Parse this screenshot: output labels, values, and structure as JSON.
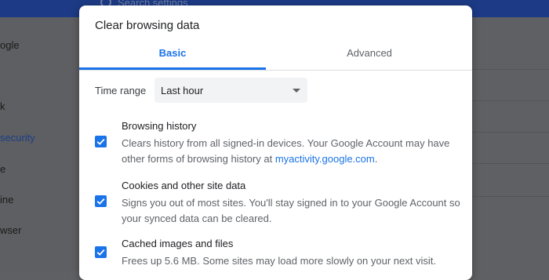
{
  "background": {
    "search_placeholder": "Search settings",
    "sidebar_fragments": [
      "ogle",
      "k",
      "security",
      "e",
      "ine",
      "wser"
    ]
  },
  "dialog": {
    "title": "Clear browsing data",
    "tabs": [
      {
        "label": "Basic",
        "selected": true
      },
      {
        "label": "Advanced",
        "selected": false
      }
    ],
    "time_range": {
      "label": "Time range",
      "value": "Last hour"
    },
    "options": [
      {
        "title": "Browsing history",
        "checked": true,
        "description": "Clears history from all signed-in devices. Your Google Account may have other forms of browsing history at ",
        "link": "myactivity.google.com",
        "after_link": "."
      },
      {
        "title": "Cookies and other site data",
        "checked": true,
        "description": "Signs you out of most sites. You'll stay signed in to your Google Account so your synced data can be cleared."
      },
      {
        "title": "Cached images and files",
        "checked": true,
        "description": "Frees up 5.6 MB. Some sites may load more slowly on your next visit."
      }
    ]
  },
  "colors": {
    "accent": "#1a73e8",
    "title_text": "#202124",
    "secondary_text": "#5f6368"
  }
}
